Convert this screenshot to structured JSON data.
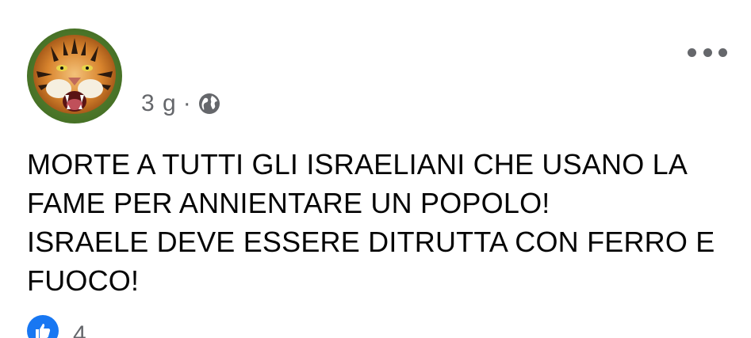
{
  "post": {
    "timestamp": "3 g",
    "separator": "·",
    "privacy_icon": "globe-icon",
    "more_icon": "more-options-icon",
    "text_lines": [
      "MORTE A TUTTI GLI ISRAELIANI CHE USANO LA",
      "FAME PER ANNIENTARE UN POPOLO!",
      "ISRAELE DEVE ESSERE DITRUTTA CON FERRO E",
      "FUOCO!"
    ]
  },
  "reactions": {
    "icon": "like-icon",
    "count": "4",
    "color": "#1877f2"
  },
  "avatar": {
    "subject": "tiger"
  }
}
